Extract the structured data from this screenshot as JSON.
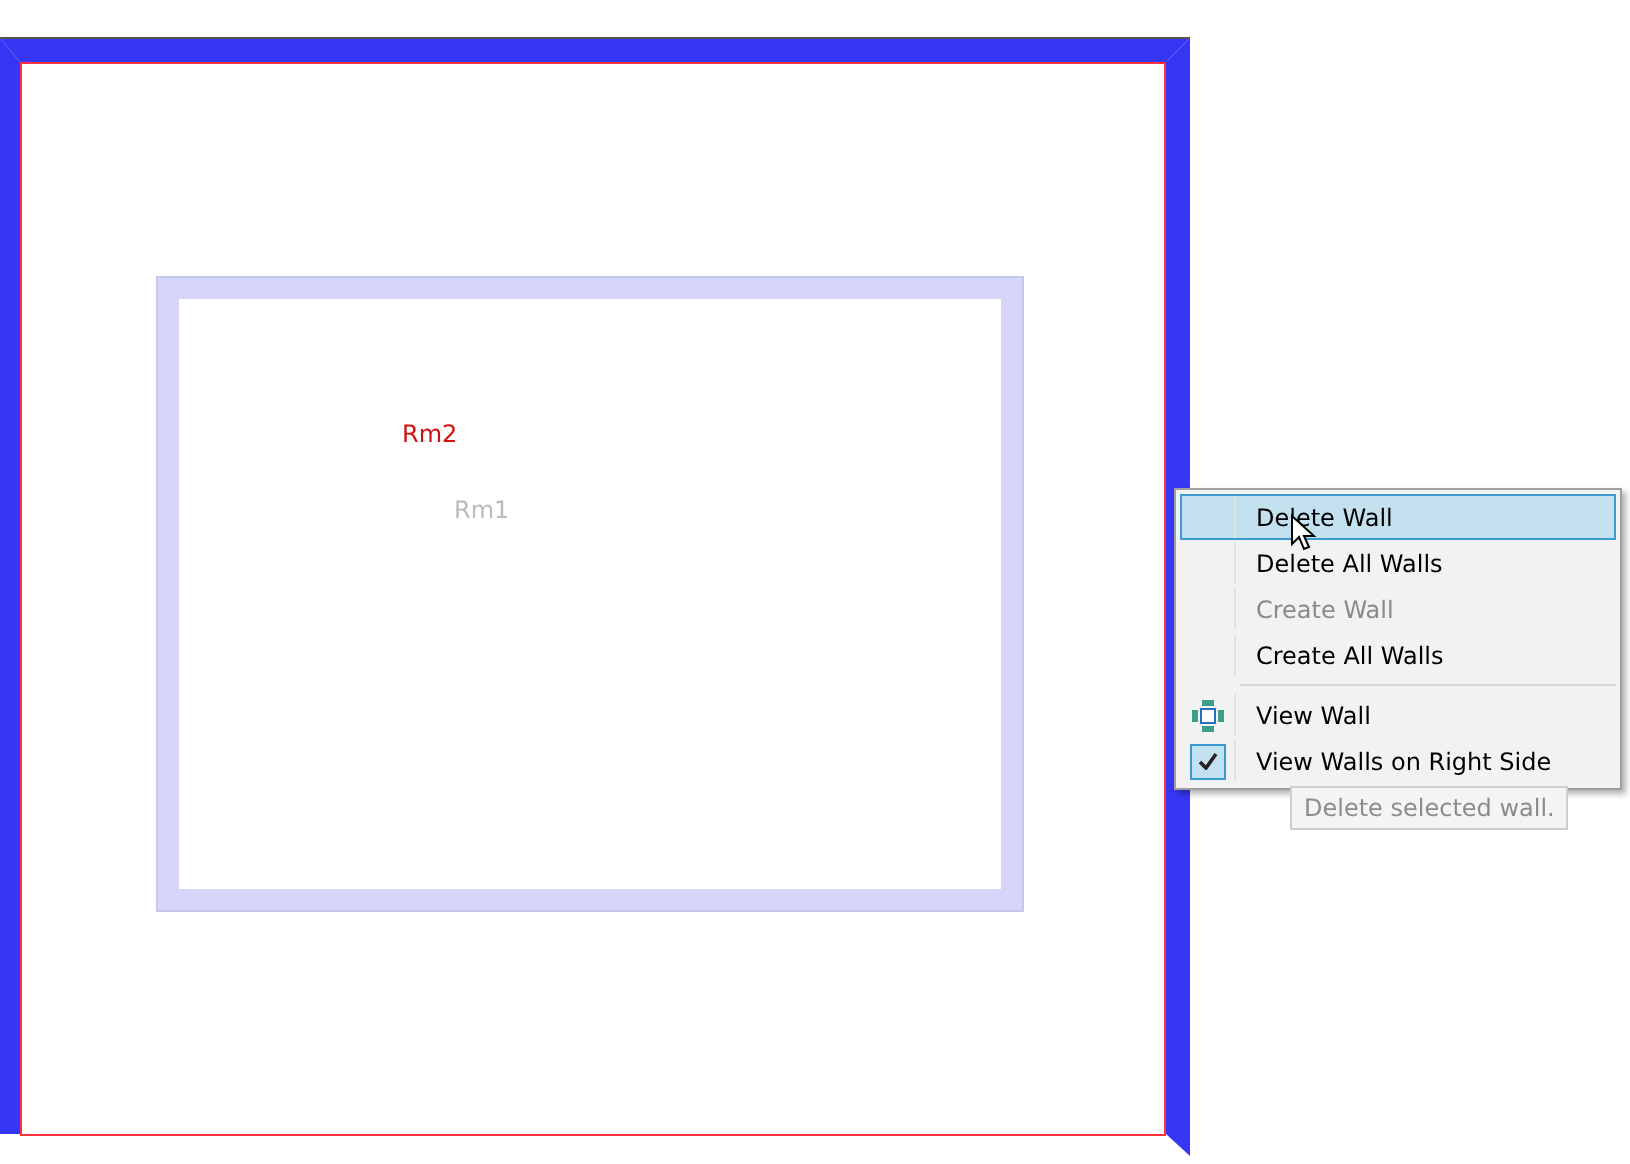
{
  "floor_plan": {
    "rooms": [
      {
        "label": "Rm2",
        "selected": true
      },
      {
        "label": "Rm1",
        "selected": false
      }
    ]
  },
  "context_menu": {
    "groups": [
      [
        {
          "label": "Delete Wall",
          "kind": "plain",
          "selected": true,
          "disabled": false
        },
        {
          "label": "Delete All Walls",
          "kind": "plain",
          "selected": false,
          "disabled": false
        },
        {
          "label": "Create Wall",
          "kind": "plain",
          "selected": false,
          "disabled": true
        },
        {
          "label": "Create All Walls",
          "kind": "plain",
          "selected": false,
          "disabled": false
        }
      ],
      [
        {
          "label": "View Wall",
          "kind": "icon",
          "selected": false,
          "disabled": false
        },
        {
          "label": "View Walls on Right Side",
          "kind": "check",
          "checked": true,
          "selected": false,
          "disabled": false
        }
      ]
    ]
  },
  "tooltip": {
    "text": "Delete selected wall."
  }
}
